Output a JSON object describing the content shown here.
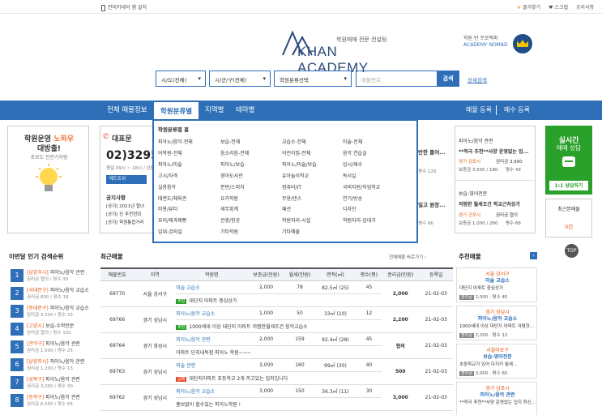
{
  "topbar": {
    "app_label": "컨미키데이 앱 설치",
    "links": [
      "즐겨찾기",
      "스크랩",
      "공지사항"
    ]
  },
  "logo": {
    "tagline": "학원매매 전문 컨설팅",
    "name": "KHAN ACADEMY",
    "nomad_line1": "학원 반 프로맥퍼",
    "nomad_line2": "ACADEMY NOMAD"
  },
  "search": {
    "sido": "시/도(전체)",
    "gugun": "시/군/구(전체)",
    "category": "학원분류선택",
    "placeholder": "매물번호",
    "button": "검색",
    "detail": "상세검색"
  },
  "nav": {
    "items": [
      "전체 매물정보",
      "학원분류별",
      "지역별",
      "테마별"
    ],
    "right": [
      "매물 등록",
      "매수 등록"
    ]
  },
  "dropdown": {
    "header": "학원분류별 홈",
    "columns": [
      [
        "피아노/음악-전체",
        "어학원-전체",
        "피아노/미술",
        "고시/자격",
        "실용음악",
        "태권도/체육관",
        "미용/뷰티",
        "요리/제과제빵",
        "입대-검외실"
      ],
      [
        "보습-전체",
        "음소리음-전체",
        "피아노/보습",
        "영어도서관",
        "분반/스피치",
        "요가학원",
        "세무회계",
        "관광/항공",
        "기타학원"
      ],
      [
        "교습소-전체",
        "어린이집-전체",
        "피아노/미술/보습",
        "유아놀이학교",
        "컴퓨터/IT",
        "무용/댄스",
        "패션",
        "학원자리-시설",
        "기타매물"
      ],
      [
        "미술-전체",
        "음악 연습실",
        "입시/재수",
        "독서실",
        "국비지원/직업학교",
        "연기/방송",
        "디자인",
        "학원자리-임대가"
      ]
    ]
  },
  "left_card": {
    "title_a": "학원운영 ",
    "title_b": "노하우",
    "title_c": "대방출!",
    "sub": "초보도 전문가처럼"
  },
  "mid_card": {
    "title": "대표문",
    "phone": "02)3295",
    "hours": "평일 09시 ~ 18시 / 상담",
    "b1": "메드트위",
    "notice": "공지사항",
    "rows": [
      "[공지] 2021년 합녀",
      "[공지] 진 추천현희",
      "[공지] 학원통합거러"
    ]
  },
  "midr_card": {
    "a": "반한 들어...",
    "b": "평수 120",
    "c": "밀고 원장...",
    "d": "평수 66"
  },
  "right_cards": [
    {
      "cat": "피아노/음악 관련",
      "desc": "**적극 추천**사양 운영없는 입...",
      "loc": "경기 김포시",
      "right": "권리금 3,900",
      "dep": "보증금 3,500 / 180",
      "area": "평수 43"
    },
    {
      "cat": "보습-영어전문",
      "desc": "저렴한 월세조건 학교근처상가",
      "loc": "경기 군포시",
      "right": "권리금 협의",
      "dep": "보증금 1,000 / 260",
      "area": "평수 66"
    }
  ],
  "counsel": {
    "a": "실시간",
    "b": "매매 상담",
    "btn": "1:1 상담하기"
  },
  "recent": {
    "title": "최근본매물",
    "count": "0건"
  },
  "rank_title": "이번달 인기 검색순위",
  "ranks": [
    {
      "no": "1",
      "region": "[남양주시]",
      "name": "피아노/음악 관련",
      "info": "권리금 협의 / 평수 30"
    },
    {
      "no": "2",
      "region": "[서대문구]",
      "name": "피아노/음악 교습소",
      "info": "권리금 800 / 평수 18"
    },
    {
      "no": "3",
      "region": "[동대문구]",
      "name": "피아노/음악 교습소",
      "info": "권리금 3,300 / 평수 33"
    },
    {
      "no": "4",
      "region": "[고양시]",
      "name": "보습-수학전문",
      "info": "권리금 협의 / 평수 150"
    },
    {
      "no": "5",
      "region": "[관악구]",
      "name": "피아노/음악 관련",
      "info": "권리금 1,500 / 평수 25"
    },
    {
      "no": "6",
      "region": "[남양주시]",
      "name": "피아노/음악 관련",
      "info": "권리금 1,200 / 평수 13"
    },
    {
      "no": "7",
      "region": "[성북구]",
      "name": "피아노/음악 관련",
      "info": "권리금 3,000 / 평수 30"
    },
    {
      "no": "8",
      "region": "[동작구]",
      "name": "피아노/음악 관련",
      "info": "권리금 6,500 / 평수 65"
    }
  ],
  "list_title": "최근매물",
  "list_link": "전체매물 바로가기 ›",
  "table": {
    "headers": [
      "매물번호",
      "지역",
      "학원명",
      "보증금(만원)",
      "월세(만원)",
      "면적(㎡)",
      "평수(평)",
      "권리금(만원)",
      "등록일"
    ],
    "rows": [
      {
        "no": "69770",
        "region": "서울 강서구",
        "name": "미술 교습소",
        "tag": "",
        "desc": "",
        "dep": "2,000",
        "rent": "78",
        "area": "82.5㎡ (25)",
        "py": "45",
        "key": "2,000",
        "date": "21-02-03"
      },
      {
        "sub": "대단지 아파트 중심상가",
        "tagc": "추천"
      },
      {
        "no": "69766",
        "region": "경기 성남시",
        "name": "피아노/음악 교습소",
        "dep": "1,000",
        "rent": "50",
        "area": "33㎡ (10)",
        "py": "12",
        "key": "2,200",
        "date": "21-02-03"
      },
      {
        "sub": "1000세대 이상 대단지 아파트 저렴한월세조건 음악교습소",
        "tagc": "추천"
      },
      {
        "no": "69764",
        "region": "경기 화성시",
        "name": "피아노/음악 관련",
        "dep": "2,000",
        "rent": "159",
        "area": "92.4㎡ (28)",
        "py": "45",
        "key": "협의",
        "date": "21-02-03"
      },
      {
        "sub": "아파트 단지내독점 피아노 학원~~~",
        "tagc": ""
      },
      {
        "no": "69763",
        "region": "경기 성남시",
        "name": "미술 관련",
        "dep": "3,000",
        "rent": "160",
        "area": "99㎡ (30)",
        "py": "40",
        "key": "500",
        "date": "21-02-03"
      },
      {
        "sub": "대단지아파트 초등학교 2개 끼고있는 입지입니다",
        "tagc": "급매"
      },
      {
        "no": "69762",
        "region": "경기 성남시",
        "name": "피아노/음악 교습소",
        "dep": "3,000",
        "rent": "150",
        "area": "36.3㎡ (11)",
        "py": "30",
        "key": "3,000",
        "date": "21-02-03"
      },
      {
        "sub": "홍보없이 할수있는 피아노학원 !",
        "tagc": ""
      }
    ]
  },
  "rec_title": "추천매물",
  "recs": [
    {
      "k": "서울 강서구",
      "l": "미술 교습소",
      "m": "대단지 아파트 중심상가",
      "tag": "권리금",
      "p": "2,000",
      "py": "45"
    },
    {
      "k": "경기 성남시",
      "l": "피아노/음악 교습소",
      "m": "1000세대 이상 대단지 아파트 저렴한...",
      "tag": "권리금",
      "p": "2,200",
      "py": "12"
    },
    {
      "k": "서울마포구",
      "l": "보습-영어전문",
      "m": "초중학교가 있어 다지키 월세...",
      "tag": "권리금",
      "p": "3,000",
      "py": "65"
    },
    {
      "k": "경기 김포시",
      "l": "피아노/음악 관련",
      "m": "**적극 추천**사양 운영없는 입지 최신...",
      "tag": "권리금",
      "p": "",
      "py": ""
    }
  ],
  "up": "TOP"
}
